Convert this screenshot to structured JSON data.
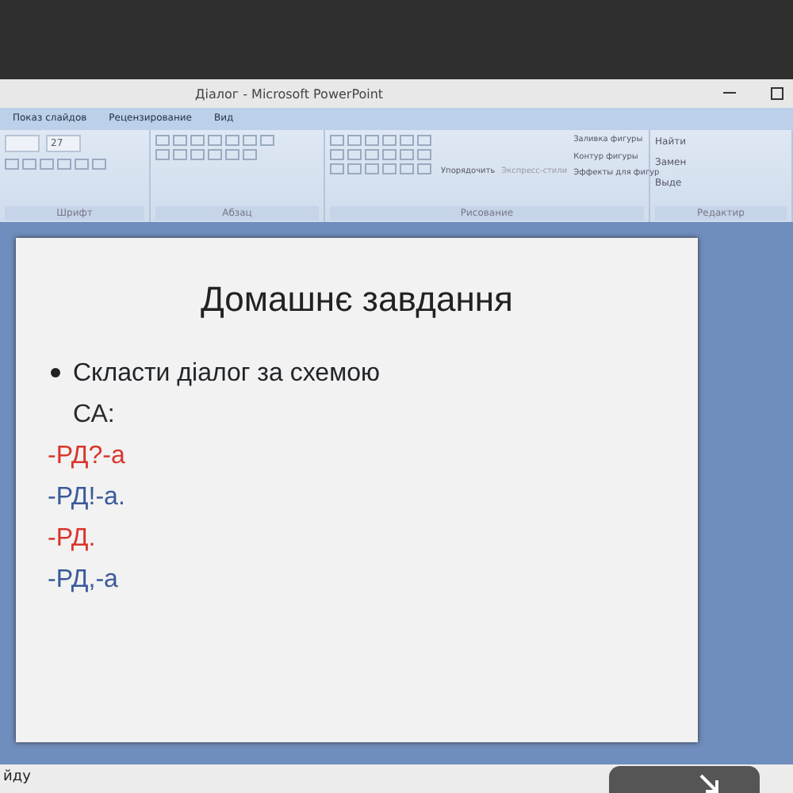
{
  "window": {
    "title": "Діалог - Microsoft PowerPoint"
  },
  "tabs": [
    {
      "label": "Показ слайдов",
      "selected": false
    },
    {
      "label": "Рецензирование",
      "selected": false
    },
    {
      "label": "Вид",
      "selected": false
    }
  ],
  "ribbon": {
    "font_size": "27",
    "groups": [
      {
        "label": "Шрифт"
      },
      {
        "label": "Абзац"
      },
      {
        "label": "Рисование"
      },
      {
        "label": "Редактир"
      }
    ],
    "arrange": "Упорядочить",
    "quick_styles": "Экспресс-стили",
    "shape_commands": [
      "Заливка фигуры",
      "Контур фигуры",
      "Эффекты для фигур"
    ],
    "edit_commands": [
      "Найти",
      "Замен",
      "Выде"
    ]
  },
  "slide": {
    "title": "Домашнє завдання",
    "bullet": "Скласти діалог за схемою",
    "lines": [
      {
        "text": "СА:",
        "color": "#2b2b2b"
      },
      {
        "text": "-РД?-а",
        "color": "#d9352b"
      },
      {
        "text": "-РД!-а.",
        "color": "#3a5a9a"
      },
      {
        "text": "-РД.",
        "color": "#d9352b"
      },
      {
        "text": "-РД,-а",
        "color": "#3a5a9a"
      }
    ]
  },
  "status_bar": {
    "text": "йду"
  }
}
